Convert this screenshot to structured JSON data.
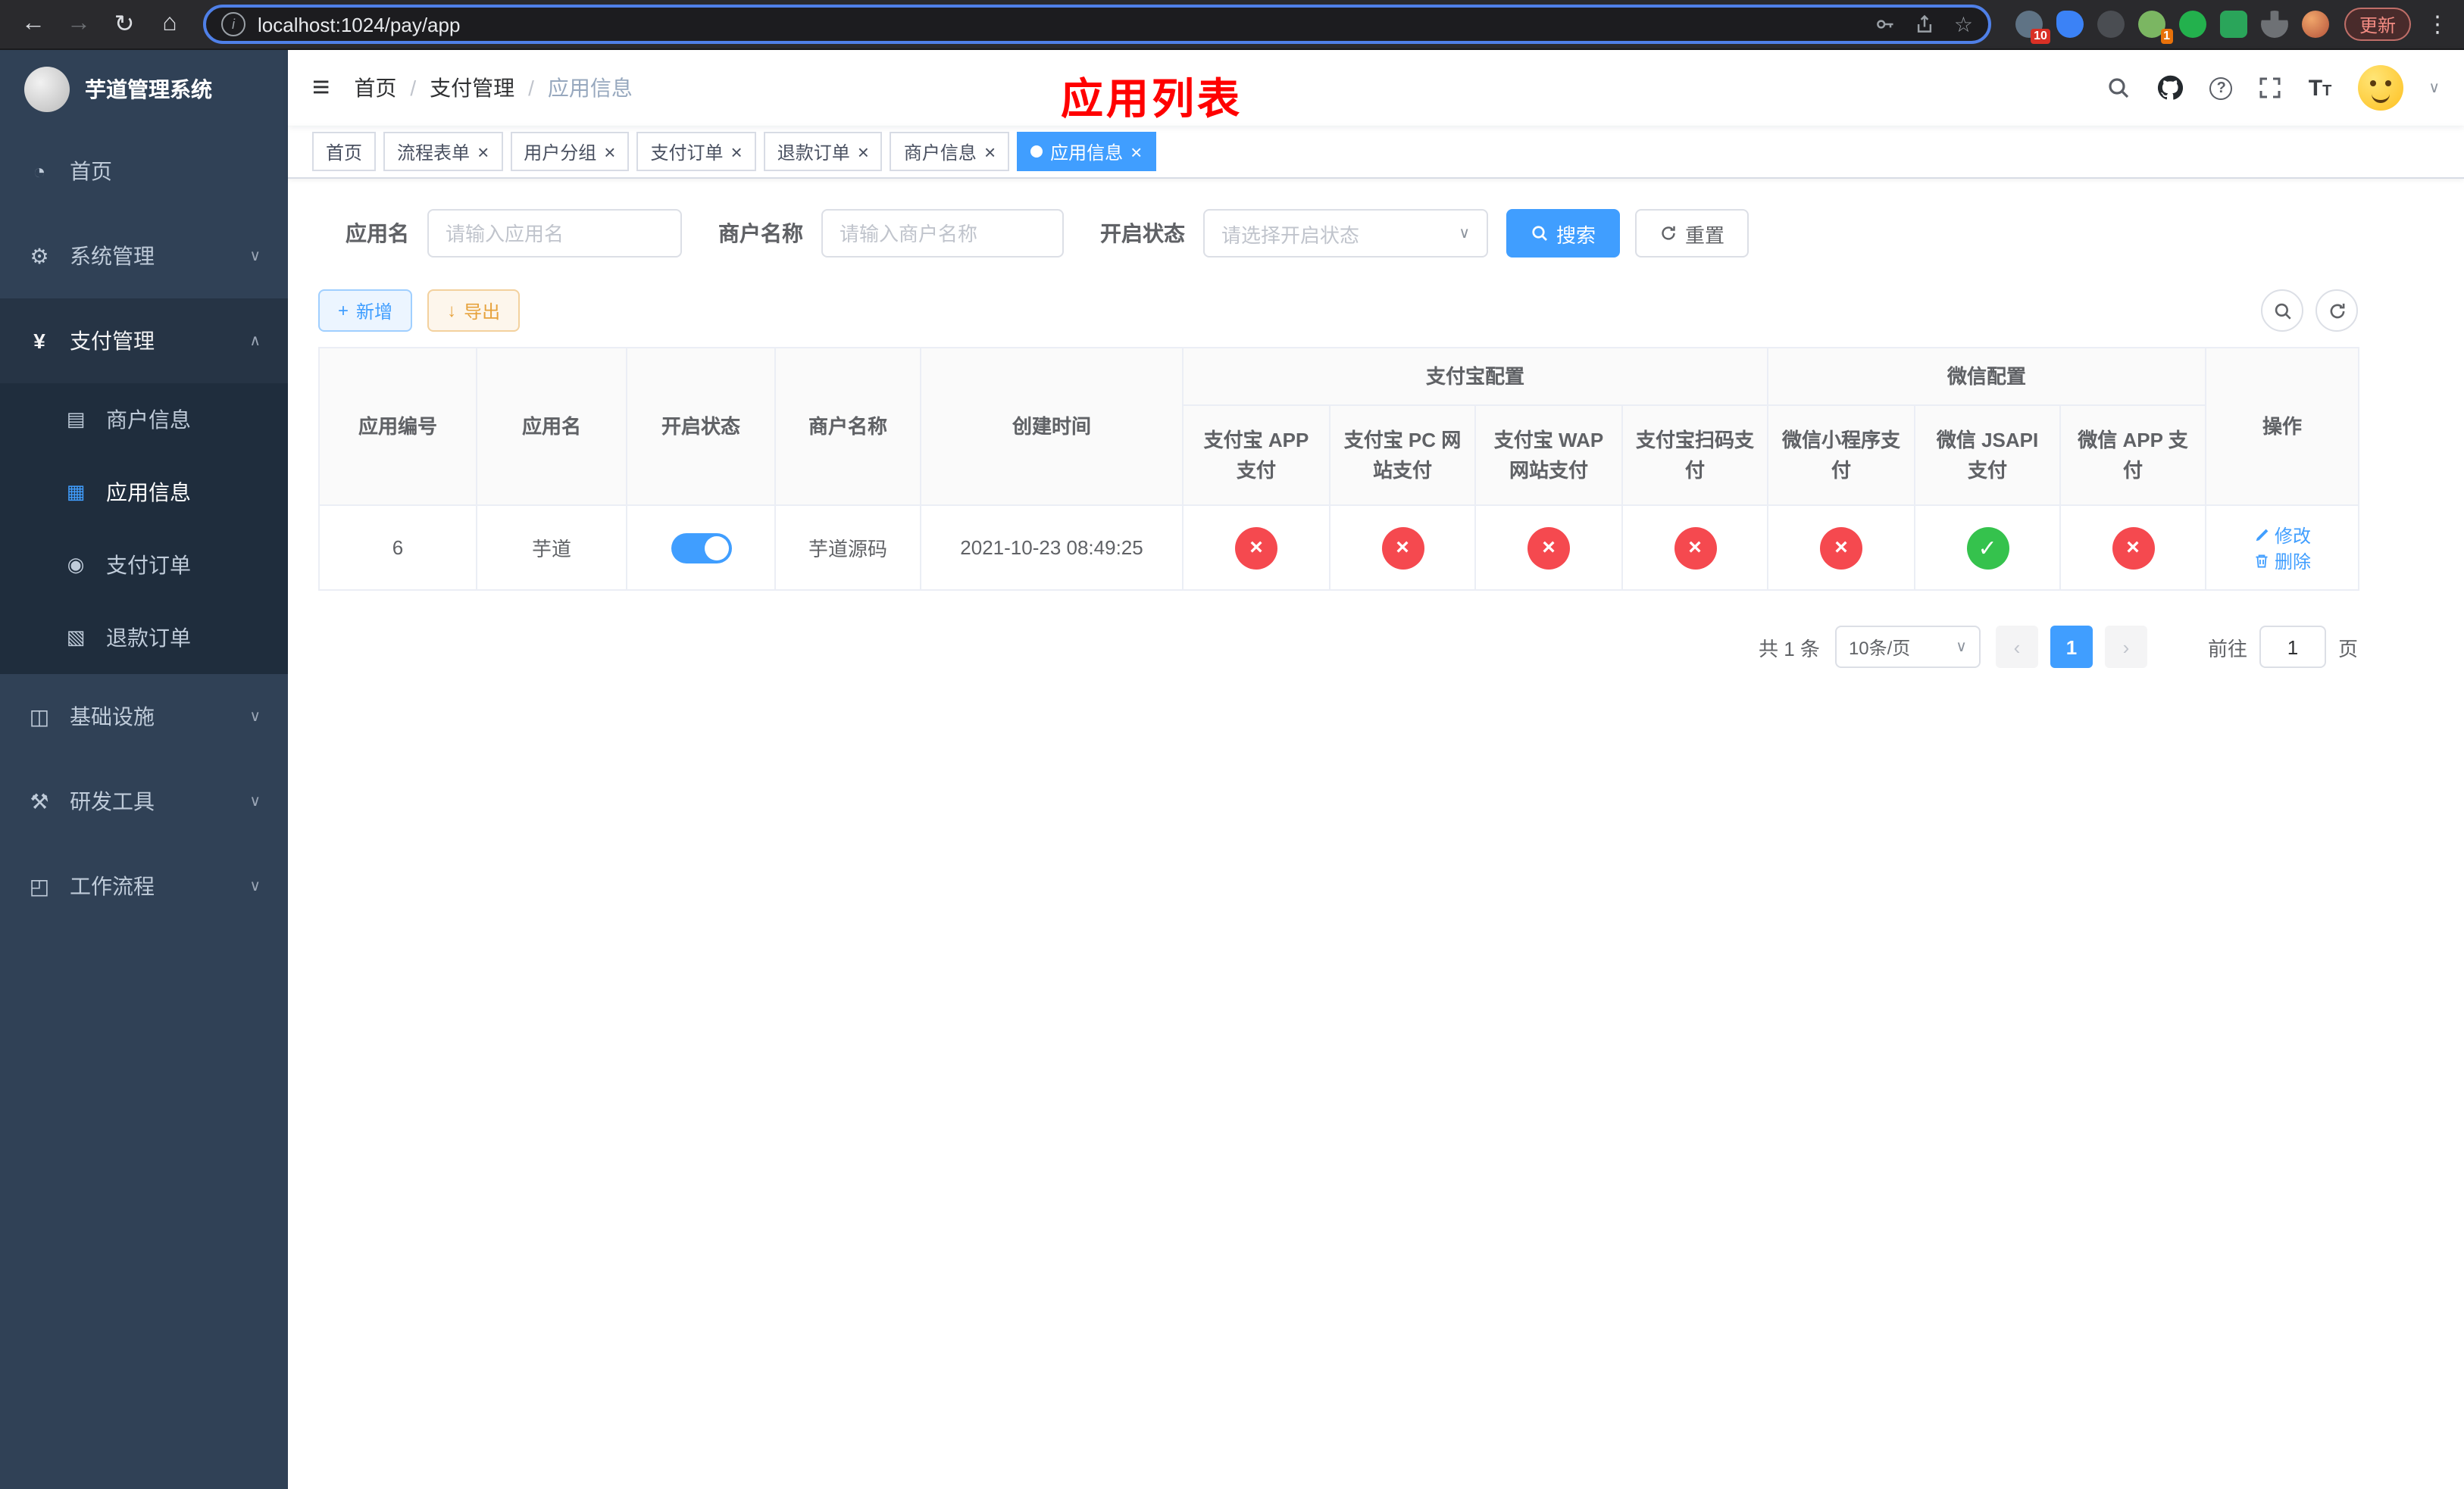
{
  "browser": {
    "url": "localhost:1024/pay/app",
    "update_label": "更新",
    "ext_badge_count": "10",
    "ext_badge_count_2": "1"
  },
  "sidebar": {
    "title": "芋道管理系统",
    "home": "首页",
    "system": "系统管理",
    "payment": "支付管理",
    "merchant_info": "商户信息",
    "app_info": "应用信息",
    "pay_order": "支付订单",
    "refund_order": "退款订单",
    "infra": "基础设施",
    "dev_tools": "研发工具",
    "workflow": "工作流程"
  },
  "header": {
    "breadcrumb": [
      "首页",
      "支付管理",
      "应用信息"
    ],
    "page_title": "应用列表"
  },
  "tabs": [
    {
      "label": "首页"
    },
    {
      "label": "流程表单"
    },
    {
      "label": "用户分组"
    },
    {
      "label": "支付订单"
    },
    {
      "label": "退款订单"
    },
    {
      "label": "商户信息"
    },
    {
      "label": "应用信息"
    }
  ],
  "filters": {
    "app_name_label": "应用名",
    "app_name_placeholder": "请输入应用名",
    "merchant_name_label": "商户名称",
    "merchant_name_placeholder": "请输入商户名称",
    "status_label": "开启状态",
    "status_placeholder": "请选择开启状态",
    "search_button": "搜索",
    "reset_button": "重置"
  },
  "toolbar": {
    "add_button": "新增",
    "export_button": "导出"
  },
  "table": {
    "group_alipay": "支付宝配置",
    "group_wechat": "微信配置",
    "col_id": "应用编号",
    "col_name": "应用名",
    "col_status": "开启状态",
    "col_merchant": "商户名称",
    "col_created": "创建时间",
    "col_alipay_app": "支付宝 APP 支付",
    "col_alipay_pc": "支付宝 PC 网站支付",
    "col_alipay_wap": "支付宝 WAP 网站支付",
    "col_alipay_qr": "支付宝扫码支付",
    "col_wx_mini": "微信小程序支付",
    "col_wx_jsapi": "微信 JSAPI 支付",
    "col_wx_app": "微信 APP 支付",
    "col_actions": "操作",
    "rows": [
      {
        "id": "6",
        "name": "芋道",
        "enabled": true,
        "merchant": "芋道源码",
        "created": "2021-10-23 08:49:25",
        "configs": [
          false,
          false,
          false,
          false,
          false,
          true,
          false
        ],
        "edit": "修改",
        "delete": "删除"
      }
    ]
  },
  "pagination": {
    "total": "共 1 条",
    "page_size": "10条/页",
    "page": "1",
    "goto": "前往",
    "goto_value": "1",
    "unit": "页"
  },
  "colors": {
    "accent": "#409eff",
    "success": "#35c24d",
    "danger": "#f5494f",
    "warning": "#e6a23c",
    "title_red": "#ff0000",
    "sidebar_bg": "#304156"
  }
}
